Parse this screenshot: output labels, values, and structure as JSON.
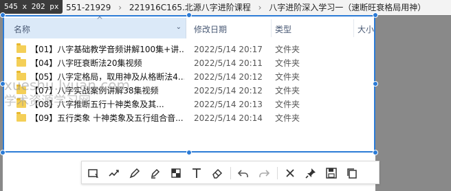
{
  "size_badge": "545 x 202 px",
  "breadcrumb": {
    "items": [
      "551-21929",
      "221916C165.北源八字进阶课程",
      "八字进阶深入学习一（速断旺衰格局用神）"
    ]
  },
  "columns": {
    "name": "名称",
    "date": "修改日期",
    "type": "类型",
    "size": "大小"
  },
  "files": [
    {
      "name": "【01】八字基础教学音频讲解100集+讲...",
      "date": "2022/5/14 20:17",
      "type": "文件夹"
    },
    {
      "name": "【04】八字旺衰断法20集视频",
      "date": "2022/5/14 20:11",
      "type": "文件夹"
    },
    {
      "name": "【05】八字定格局，取用神及从格断法4...",
      "date": "2022/5/14 20:12",
      "type": "文件夹"
    },
    {
      "name": "【07】八字实战案例讲解38集视频",
      "date": "2022/5/14 20:12",
      "type": "文件夹"
    },
    {
      "name": "【08】八字推断五行十神类象及其...",
      "date": "2022/5/14 20:13",
      "type": "文件夹"
    },
    {
      "name": "【09】五行类象 十神类象及五行组合音...",
      "date": "2022/5/14 20:14",
      "type": "文件夹"
    }
  ],
  "watermark": {
    "line1": "xueshu.lyuan.com",
    "line2": "学术资源学习网"
  },
  "toolbar": {
    "tools": [
      "rectangle-icon",
      "line-icon",
      "pen-icon",
      "marker-icon",
      "mosaic-icon",
      "text-icon",
      "eraser-icon",
      "undo-icon",
      "redo-icon",
      "close-icon",
      "pin-icon",
      "save-icon",
      "copy-icon"
    ]
  },
  "colors": {
    "selection_accent": "#2b7bd6",
    "folder": "#f4cf57",
    "header_highlight": "#dbe9f8"
  }
}
